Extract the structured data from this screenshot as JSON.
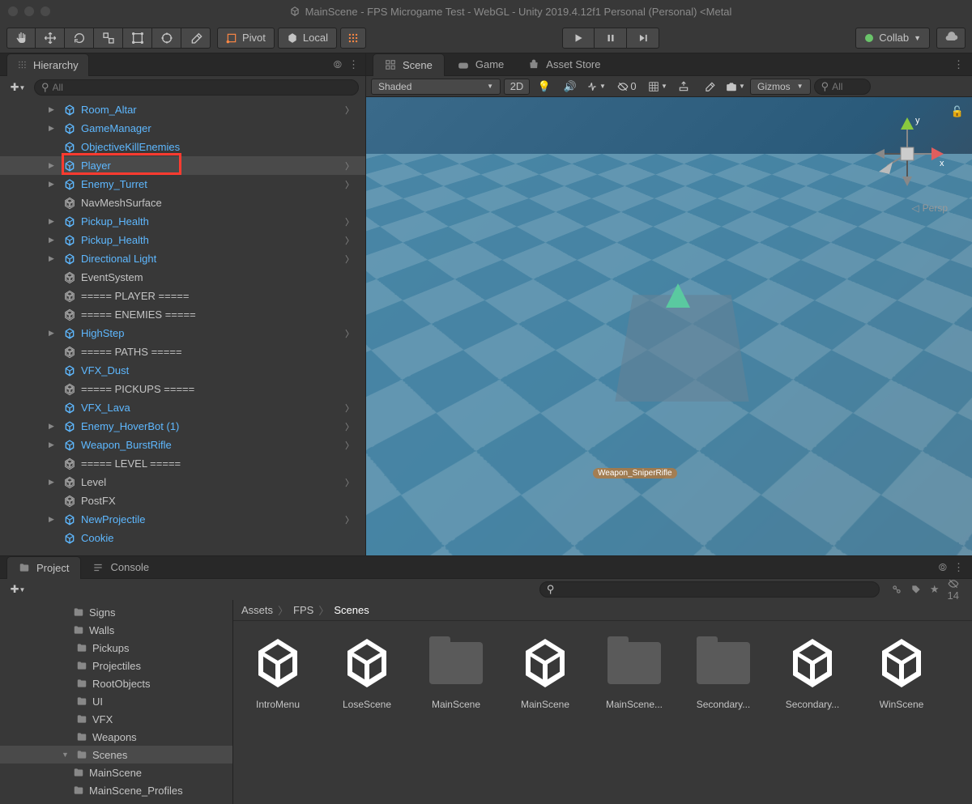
{
  "titlebar": {
    "text": "MainScene - FPS Microgame Test - WebGL - Unity 2019.4.12f1 Personal (Personal) <Metal"
  },
  "toolbar": {
    "pivot": "Pivot",
    "local": "Local",
    "collab": "Collab"
  },
  "hierarchy": {
    "title": "Hierarchy",
    "search_placeholder": "All",
    "items": [
      {
        "label": "Room_Altar",
        "blue": true,
        "arrow": true,
        "chevron": true
      },
      {
        "label": "GameManager",
        "blue": true,
        "arrow": true,
        "chevron": false
      },
      {
        "label": "ObjectiveKillEnemies",
        "blue": true,
        "arrow": false,
        "chevron": false
      },
      {
        "label": "Player",
        "blue": true,
        "arrow": true,
        "chevron": true,
        "selected": true,
        "highlighted": true
      },
      {
        "label": "Enemy_Turret",
        "blue": true,
        "arrow": true,
        "chevron": true
      },
      {
        "label": "NavMeshSurface",
        "blue": false,
        "arrow": false,
        "chevron": false
      },
      {
        "label": "Pickup_Health",
        "blue": true,
        "arrow": true,
        "chevron": true
      },
      {
        "label": "Pickup_Health",
        "blue": true,
        "arrow": true,
        "chevron": true
      },
      {
        "label": "Directional Light",
        "blue": true,
        "arrow": true,
        "chevron": true
      },
      {
        "label": "EventSystem",
        "blue": false,
        "arrow": false,
        "chevron": false
      },
      {
        "label": "===== PLAYER =====",
        "blue": false,
        "arrow": false,
        "chevron": false
      },
      {
        "label": "===== ENEMIES =====",
        "blue": false,
        "arrow": false,
        "chevron": false
      },
      {
        "label": "HighStep",
        "blue": true,
        "arrow": true,
        "chevron": true
      },
      {
        "label": "===== PATHS =====",
        "blue": false,
        "arrow": false,
        "chevron": false
      },
      {
        "label": "VFX_Dust",
        "blue": true,
        "arrow": false,
        "chevron": false
      },
      {
        "label": "===== PICKUPS =====",
        "blue": false,
        "arrow": false,
        "chevron": false
      },
      {
        "label": "VFX_Lava",
        "blue": true,
        "arrow": false,
        "chevron": true
      },
      {
        "label": "Enemy_HoverBot (1)",
        "blue": true,
        "arrow": true,
        "chevron": true
      },
      {
        "label": "Weapon_BurstRifle",
        "blue": true,
        "arrow": true,
        "chevron": true
      },
      {
        "label": "===== LEVEL =====",
        "blue": false,
        "arrow": false,
        "chevron": false
      },
      {
        "label": "Level",
        "blue": false,
        "arrow": true,
        "chevron": true
      },
      {
        "label": "PostFX",
        "blue": false,
        "arrow": false,
        "chevron": false
      },
      {
        "label": "NewProjectile",
        "blue": true,
        "arrow": true,
        "chevron": true
      },
      {
        "label": "Cookie",
        "blue": true,
        "arrow": false,
        "chevron": false
      }
    ]
  },
  "scene": {
    "tabs": {
      "scene": "Scene",
      "game": "Game",
      "asset_store": "Asset Store"
    },
    "shaded": "Shaded",
    "mode_2d": "2D",
    "hidden_count": "0",
    "gizmos": "Gizmos",
    "search_placeholder": "All",
    "persp": "Persp",
    "weapon_label": "Weapon_SniperRifle",
    "axis_x": "x",
    "axis_y": "y"
  },
  "project": {
    "tabs": {
      "project": "Project",
      "console": "Console"
    },
    "hidden_count": "14",
    "folders": [
      {
        "label": "Signs",
        "indent": false
      },
      {
        "label": "Walls",
        "indent": false
      },
      {
        "label": "Pickups",
        "indent": true
      },
      {
        "label": "Projectiles",
        "indent": true
      },
      {
        "label": "RootObjects",
        "indent": true
      },
      {
        "label": "UI",
        "indent": true
      },
      {
        "label": "VFX",
        "indent": true
      },
      {
        "label": "Weapons",
        "indent": true
      },
      {
        "label": "Scenes",
        "indent": true,
        "selected": true,
        "arrow": "down"
      },
      {
        "label": "MainScene",
        "indent": false
      },
      {
        "label": "MainScene_Profiles",
        "indent": false,
        "cut": true
      }
    ],
    "breadcrumb": [
      "Assets",
      "FPS",
      "Scenes"
    ],
    "assets": [
      {
        "label": "IntroMenu",
        "type": "unity"
      },
      {
        "label": "LoseScene",
        "type": "unity"
      },
      {
        "label": "MainScene",
        "type": "folder"
      },
      {
        "label": "MainScene",
        "type": "unity"
      },
      {
        "label": "MainScene...",
        "type": "folder"
      },
      {
        "label": "Secondary...",
        "type": "folder"
      },
      {
        "label": "Secondary...",
        "type": "unity"
      },
      {
        "label": "WinScene",
        "type": "unity"
      }
    ]
  }
}
